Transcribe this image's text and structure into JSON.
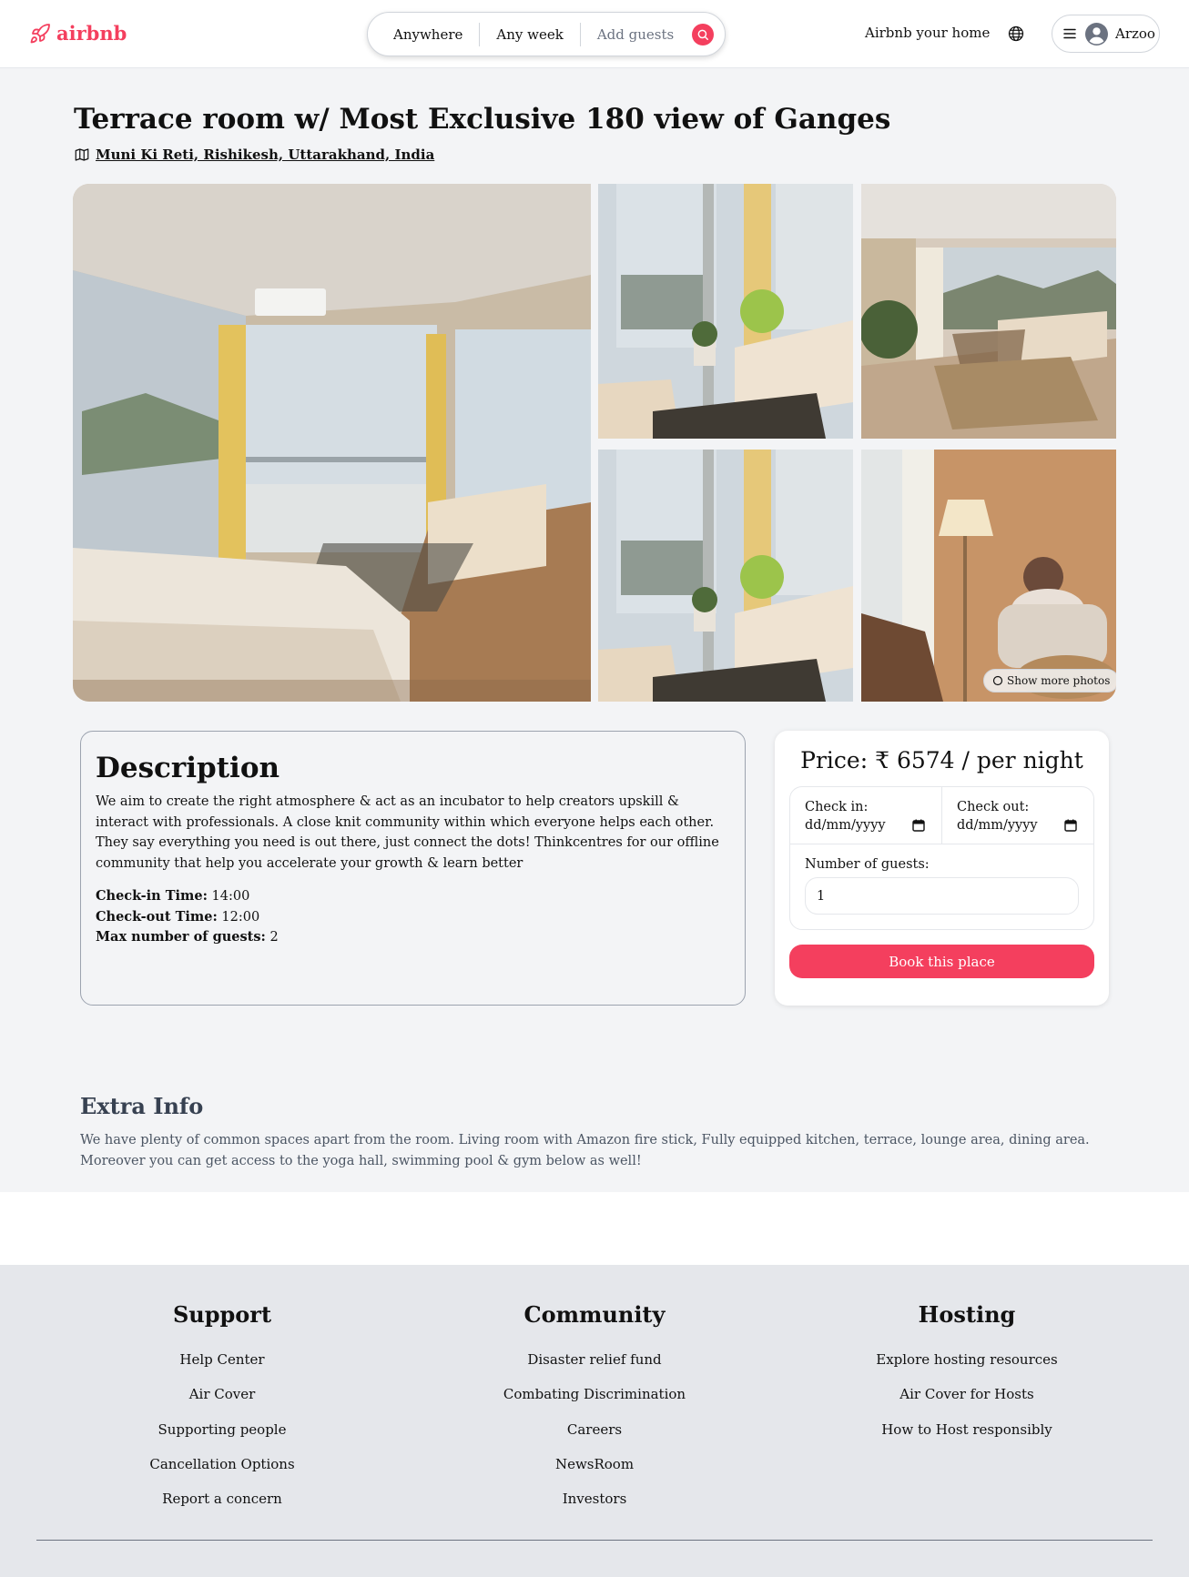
{
  "header": {
    "logo_text": "airbnb",
    "search": {
      "where": "Anywhere",
      "when": "Any week",
      "guests": "Add guests"
    },
    "host_link": "Airbnb your home",
    "user_name": "Arzoo",
    "accent_color": "#f43f5e"
  },
  "listing": {
    "title": "Terrace room w/ Most Exclusive 180 view of Ganges",
    "address": "Muni Ki Reti, Rishikesh, Uttarakhand, India",
    "show_more_photos": "Show more photos"
  },
  "description": {
    "heading": "Description",
    "text": "We aim to create the right atmosphere & act as an incubator to help creators upskill & interact with professionals. A close knit community within which everyone helps each other. They say everything you need is out there, just connect the dots! Thinkcentres for our offline community that help you accelerate your growth & learn better",
    "checkin_label": "Check-in Time:",
    "checkin_value": "14:00",
    "checkout_label": "Check-out Time:",
    "checkout_value": "12:00",
    "max_guests_label": "Max number of guests:",
    "max_guests_value": "2"
  },
  "booking": {
    "price": "Price: ₹ 6574 / per night",
    "checkin_label": "Check in:",
    "checkin_placeholder": "dd/mm/yyyy",
    "checkout_label": "Check out:",
    "checkout_placeholder": "dd/mm/yyyy",
    "guests_label": "Number of guests:",
    "guests_value": "1",
    "book_button": "Book this place"
  },
  "extra": {
    "heading": "Extra Info",
    "text": "We have plenty of common spaces apart from the room. Living room with Amazon fire stick, Fully equipped kitchen, terrace, lounge area, dining area. Moreover you can get access to the yoga hall, swimming pool & gym below as well!"
  },
  "footer": {
    "support": {
      "heading": "Support",
      "links": [
        "Help Center",
        "Air Cover",
        "Supporting people",
        "Cancellation Options",
        "Report a concern"
      ]
    },
    "community": {
      "heading": "Community",
      "links": [
        "Disaster relief fund",
        "Combating Discrimination",
        "Careers",
        "NewsRoom",
        "Investors"
      ]
    },
    "hosting": {
      "heading": "Hosting",
      "links": [
        "Explore hosting resources",
        "Air Cover for Hosts",
        "How to Host responsibly"
      ]
    }
  }
}
